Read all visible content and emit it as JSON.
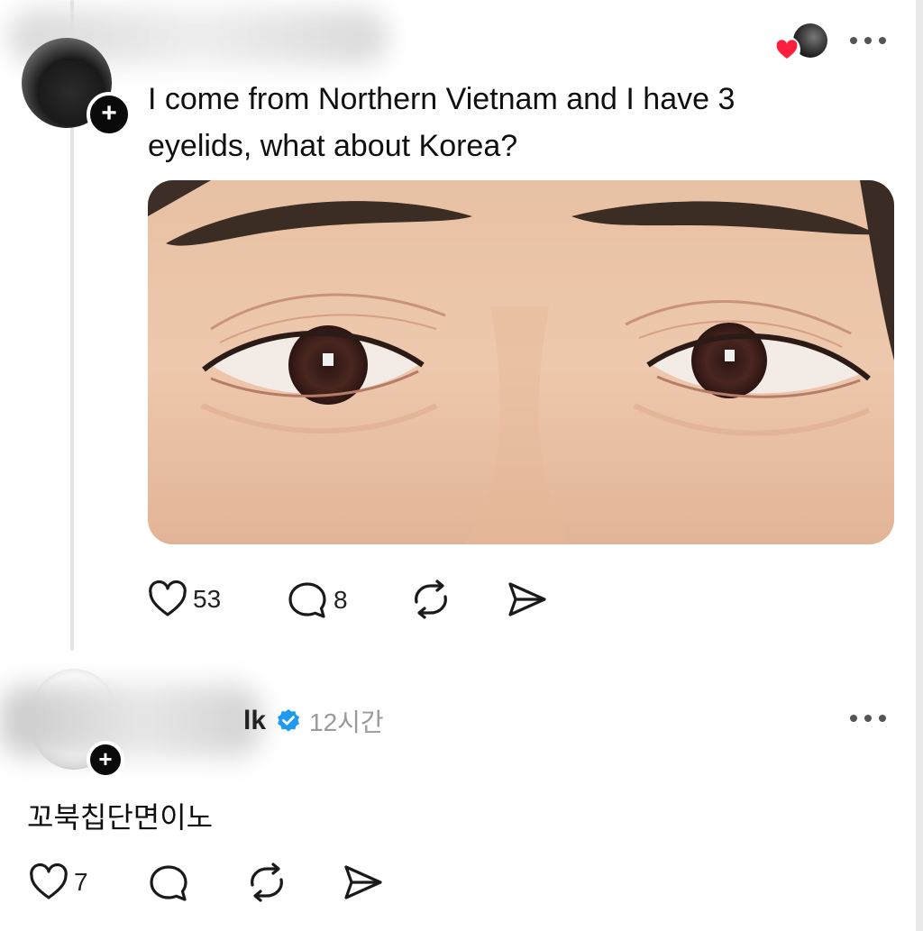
{
  "post": {
    "text": "I come from Northern Vietnam and I have 3 eyelids, what about Korea?",
    "likes": "53",
    "comments": "8"
  },
  "reply": {
    "username": "lk",
    "time": "12시간",
    "text": "꼬북칩단면이노",
    "likes": "7"
  },
  "colors": {
    "verified": "#1d9bf0",
    "heart_red": "#ff1f3d"
  },
  "icons": {
    "like": "heart-outline-icon",
    "comment": "speech-bubble-icon",
    "repost": "repost-arrows-icon",
    "share": "paper-plane-icon",
    "more": "ellipsis-icon",
    "follow": "plus-icon",
    "verified": "verified-badge-icon"
  }
}
